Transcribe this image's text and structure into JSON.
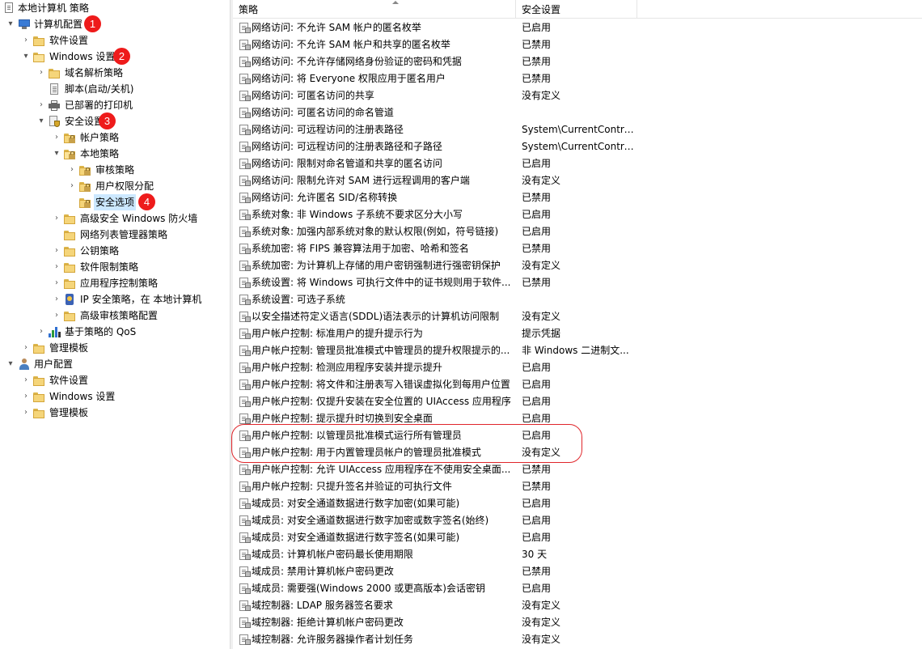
{
  "tree": {
    "root": "本地计算机 策略",
    "nodes": [
      {
        "id": "computer-config",
        "label": "计算机配置",
        "expander": "▾",
        "icon": "pc-icon"
      },
      {
        "id": "software-settings",
        "label": "软件设置",
        "expander": "›",
        "icon": "folder-icon"
      },
      {
        "id": "windows-settings",
        "label": "Windows 设置",
        "expander": "▾",
        "icon": "folder-icon"
      },
      {
        "id": "name-resolution-policy",
        "label": "域名解析策略",
        "expander": "›",
        "icon": "folder-icon"
      },
      {
        "id": "scripts",
        "label": "脚本(启动/关机)",
        "expander": "",
        "icon": "script-icon"
      },
      {
        "id": "deployed-printers",
        "label": "已部署的打印机",
        "expander": "›",
        "icon": "printer-icon"
      },
      {
        "id": "security-settings",
        "label": "安全设置",
        "expander": "▾",
        "icon": "security-icon"
      },
      {
        "id": "account-policies",
        "label": "帐户策略",
        "expander": "›",
        "icon": "locked-folder-icon"
      },
      {
        "id": "local-policies",
        "label": "本地策略",
        "expander": "▾",
        "icon": "locked-folder-icon"
      },
      {
        "id": "audit-policy",
        "label": "审核策略",
        "expander": "›",
        "icon": "locked-folder-icon"
      },
      {
        "id": "user-rights",
        "label": "用户权限分配",
        "expander": "›",
        "icon": "locked-folder-icon"
      },
      {
        "id": "security-options",
        "label": "安全选项",
        "expander": "",
        "icon": "locked-folder-icon"
      },
      {
        "id": "firewall",
        "label": "高级安全 Windows 防火墙",
        "expander": "›",
        "icon": "folder-icon"
      },
      {
        "id": "network-list",
        "label": "网络列表管理器策略",
        "expander": "",
        "icon": "folder-icon"
      },
      {
        "id": "public-key",
        "label": "公钥策略",
        "expander": "›",
        "icon": "folder-icon"
      },
      {
        "id": "software-restriction",
        "label": "软件限制策略",
        "expander": "›",
        "icon": "folder-icon"
      },
      {
        "id": "app-control",
        "label": "应用程序控制策略",
        "expander": "›",
        "icon": "folder-icon"
      },
      {
        "id": "ip-security",
        "label": "IP 安全策略，在 本地计算机",
        "expander": "›",
        "icon": "ip-security-icon"
      },
      {
        "id": "advanced-audit",
        "label": "高级审核策略配置",
        "expander": "›",
        "icon": "folder-icon"
      },
      {
        "id": "qos",
        "label": "基于策略的 QoS",
        "expander": "›",
        "icon": "qos-chart-icon"
      },
      {
        "id": "admin-templates",
        "label": "管理模板",
        "expander": "›",
        "icon": "folder-icon"
      },
      {
        "id": "user-config",
        "label": "用户配置",
        "expander": "▾",
        "icon": "user-icon"
      },
      {
        "id": "user-software-settings",
        "label": "软件设置",
        "expander": "›",
        "icon": "folder-icon"
      },
      {
        "id": "user-windows-settings",
        "label": "Windows 设置",
        "expander": "›",
        "icon": "folder-icon"
      },
      {
        "id": "user-admin-templates",
        "label": "管理模板",
        "expander": "›",
        "icon": "folder-icon"
      }
    ]
  },
  "badges": [
    "1",
    "2",
    "3",
    "4"
  ],
  "list": {
    "headers": {
      "policy": "策略",
      "setting": "安全设置"
    },
    "rows": [
      {
        "policy": "网络访问: 不允许 SAM 帐户的匿名枚举",
        "setting": "已启用"
      },
      {
        "policy": "网络访问: 不允许 SAM 帐户和共享的匿名枚举",
        "setting": "已禁用"
      },
      {
        "policy": "网络访问: 不允许存储网络身份验证的密码和凭据",
        "setting": "已禁用"
      },
      {
        "policy": "网络访问: 将 Everyone 权限应用于匿名用户",
        "setting": "已禁用"
      },
      {
        "policy": "网络访问: 可匿名访问的共享",
        "setting": "没有定义"
      },
      {
        "policy": "网络访问: 可匿名访问的命名管道",
        "setting": ""
      },
      {
        "policy": "网络访问: 可远程访问的注册表路径",
        "setting": "System\\CurrentContro..."
      },
      {
        "policy": "网络访问: 可远程访问的注册表路径和子路径",
        "setting": "System\\CurrentContro..."
      },
      {
        "policy": "网络访问: 限制对命名管道和共享的匿名访问",
        "setting": "已启用"
      },
      {
        "policy": "网络访问: 限制允许对 SAM 进行远程调用的客户端",
        "setting": "没有定义"
      },
      {
        "policy": "网络访问: 允许匿名 SID/名称转换",
        "setting": "已禁用"
      },
      {
        "policy": "系统对象: 非 Windows 子系统不要求区分大小写",
        "setting": "已启用"
      },
      {
        "policy": "系统对象: 加强内部系统对象的默认权限(例如，符号链接)",
        "setting": "已启用"
      },
      {
        "policy": "系统加密: 将 FIPS 兼容算法用于加密、哈希和签名",
        "setting": "已禁用"
      },
      {
        "policy": "系统加密: 为计算机上存储的用户密钥强制进行强密钥保护",
        "setting": "没有定义"
      },
      {
        "policy": "系统设置: 将 Windows 可执行文件中的证书规则用于软件...",
        "setting": "已禁用"
      },
      {
        "policy": "系统设置: 可选子系统",
        "setting": ""
      },
      {
        "policy": "以安全描述符定义语言(SDDL)语法表示的计算机访问限制",
        "setting": "没有定义"
      },
      {
        "policy": "用户帐户控制: 标准用户的提升提示行为",
        "setting": "提示凭据"
      },
      {
        "policy": "用户帐户控制: 管理员批准模式中管理员的提升权限提示的...",
        "setting": "非 Windows 二进制文..."
      },
      {
        "policy": "用户帐户控制: 检测应用程序安装并提示提升",
        "setting": "已启用"
      },
      {
        "policy": "用户帐户控制: 将文件和注册表写入错误虚拟化到每用户位置",
        "setting": "已启用"
      },
      {
        "policy": "用户帐户控制: 仅提升安装在安全位置的 UIAccess 应用程序",
        "setting": "已启用"
      },
      {
        "policy": "用户帐户控制: 提示提升时切换到安全桌面",
        "setting": "已启用"
      },
      {
        "policy": "用户帐户控制: 以管理员批准模式运行所有管理员",
        "setting": "已启用"
      },
      {
        "policy": "用户帐户控制: 用于内置管理员帐户的管理员批准模式",
        "setting": "没有定义"
      },
      {
        "policy": "用户帐户控制: 允许 UIAccess 应用程序在不使用安全桌面...",
        "setting": "已禁用"
      },
      {
        "policy": "用户帐户控制: 只提升签名并验证的可执行文件",
        "setting": "已禁用"
      },
      {
        "policy": "域成员: 对安全通道数据进行数字加密(如果可能)",
        "setting": "已启用"
      },
      {
        "policy": "域成员: 对安全通道数据进行数字加密或数字签名(始终)",
        "setting": "已启用"
      },
      {
        "policy": "域成员: 对安全通道数据进行数字签名(如果可能)",
        "setting": "已启用"
      },
      {
        "policy": "域成员: 计算机帐户密码最长使用期限",
        "setting": "30 天"
      },
      {
        "policy": "域成员: 禁用计算机帐户密码更改",
        "setting": "已禁用"
      },
      {
        "policy": "域成员: 需要强(Windows 2000 或更高版本)会话密钥",
        "setting": "已启用"
      },
      {
        "policy": "域控制器: LDAP 服务器签名要求",
        "setting": "没有定义"
      },
      {
        "policy": "域控制器: 拒绝计算机帐户密码更改",
        "setting": "没有定义"
      },
      {
        "policy": "域控制器: 允许服务器操作者计划任务",
        "setting": "没有定义"
      }
    ]
  }
}
